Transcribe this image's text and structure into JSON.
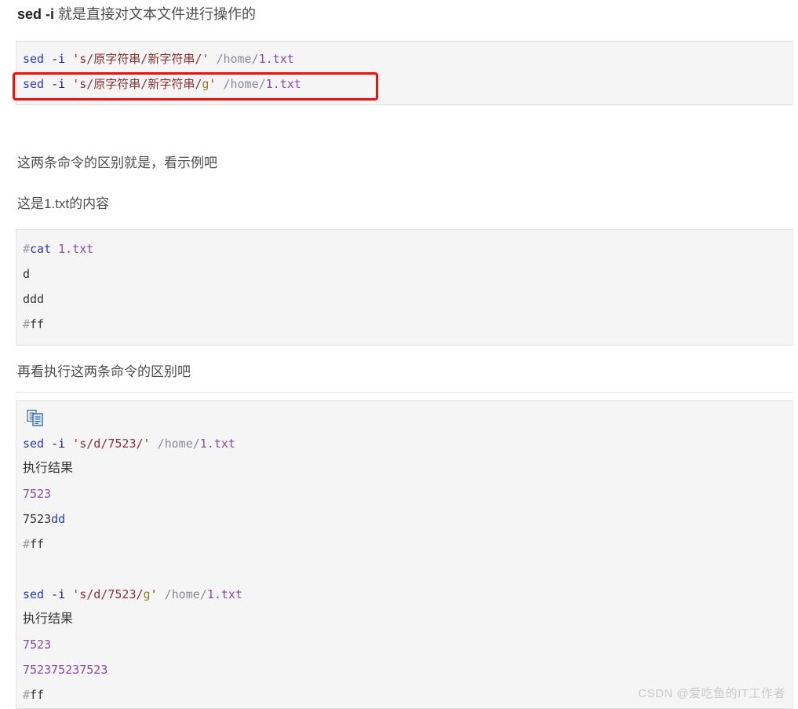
{
  "document": {
    "heading": {
      "bold_part": "sed -i",
      "rest_part": " 就是直接对文本文件进行操作的"
    },
    "paragraphs": {
      "p1": "这两条命令的区别就是，看示例吧",
      "p2": "这是1.txt的内容",
      "p3": "再看执行这两条命令的区别吧"
    },
    "watermark": "CSDN @爱吃鱼的IT工作者"
  },
  "code_block_1": {
    "name": "sed-inplace-syntax",
    "lines": [
      {
        "id": "line1",
        "tokens": [
          {
            "t": "sed",
            "c": "tk-cmd"
          },
          {
            "t": " ",
            "c": "tk-plain"
          },
          {
            "t": "-i",
            "c": "tk-opt"
          },
          {
            "t": " ",
            "c": "tk-plain"
          },
          {
            "t": "'s/原字符串/新字符串/'",
            "c": "tk-str"
          },
          {
            "t": " ",
            "c": "tk-plain"
          },
          {
            "t": "/home/",
            "c": "tk-path"
          },
          {
            "t": "1.txt",
            "c": "tk-num"
          }
        ]
      },
      {
        "id": "line2",
        "tokens": [
          {
            "t": "sed",
            "c": "tk-cmd"
          },
          {
            "t": " ",
            "c": "tk-plain"
          },
          {
            "t": "-i",
            "c": "tk-opt"
          },
          {
            "t": " ",
            "c": "tk-plain"
          },
          {
            "t": "'s/原字符串/新字符串/",
            "c": "tk-str"
          },
          {
            "t": "g",
            "c": "tk-g"
          },
          {
            "t": "'",
            "c": "tk-str"
          },
          {
            "t": " ",
            "c": "tk-plain"
          },
          {
            "t": "/home/",
            "c": "tk-path"
          },
          {
            "t": "1.txt",
            "c": "tk-num"
          }
        ]
      }
    ]
  },
  "code_block_2": {
    "name": "cat-file-contents",
    "lines": [
      {
        "id": "line1",
        "tokens": [
          {
            "t": "#",
            "c": "tk-hash"
          },
          {
            "t": "cat",
            "c": "tk-cmd"
          },
          {
            "t": " ",
            "c": "tk-plain"
          },
          {
            "t": "1.txt",
            "c": "tk-num"
          }
        ]
      },
      {
        "id": "line2",
        "tokens": [
          {
            "t": "d",
            "c": "tk-plain"
          }
        ]
      },
      {
        "id": "line3",
        "tokens": [
          {
            "t": "ddd",
            "c": "tk-plain"
          }
        ]
      },
      {
        "id": "line4",
        "tokens": [
          {
            "t": "#",
            "c": "tk-hash"
          },
          {
            "t": "ff",
            "c": "tk-plain"
          }
        ]
      }
    ]
  },
  "code_block_3": {
    "name": "sed-execution-results",
    "copy_icon_label": "copy-to-clipboard",
    "lines": [
      {
        "id": "line1",
        "cjk": false,
        "tokens": [
          {
            "t": "sed",
            "c": "tk-cmd"
          },
          {
            "t": " ",
            "c": "tk-plain"
          },
          {
            "t": "-i",
            "c": "tk-opt"
          },
          {
            "t": " ",
            "c": "tk-plain"
          },
          {
            "t": "'s/d/7523/'",
            "c": "tk-str"
          },
          {
            "t": " ",
            "c": "tk-plain"
          },
          {
            "t": "/home/",
            "c": "tk-path"
          },
          {
            "t": "1.txt",
            "c": "tk-num"
          }
        ]
      },
      {
        "id": "line2",
        "cjk": true,
        "tokens": [
          {
            "t": "执行结果",
            "c": "tk-plain"
          }
        ]
      },
      {
        "id": "line3",
        "cjk": false,
        "tokens": [
          {
            "t": "7523",
            "c": "tk-num"
          }
        ]
      },
      {
        "id": "line4",
        "cjk": false,
        "tokens": [
          {
            "t": "7523",
            "c": "tk-plain"
          },
          {
            "t": "dd",
            "c": "tk-blue"
          }
        ]
      },
      {
        "id": "line5",
        "cjk": false,
        "tokens": [
          {
            "t": "#",
            "c": "tk-hash"
          },
          {
            "t": "ff",
            "c": "tk-plain"
          }
        ]
      },
      {
        "id": "line6",
        "cjk": false,
        "tokens": []
      },
      {
        "id": "line7",
        "cjk": false,
        "tokens": [
          {
            "t": "sed",
            "c": "tk-cmd"
          },
          {
            "t": " ",
            "c": "tk-plain"
          },
          {
            "t": "-i",
            "c": "tk-opt"
          },
          {
            "t": " ",
            "c": "tk-plain"
          },
          {
            "t": "'s/d/7523/",
            "c": "tk-str"
          },
          {
            "t": "g",
            "c": "tk-g"
          },
          {
            "t": "'",
            "c": "tk-str"
          },
          {
            "t": " ",
            "c": "tk-plain"
          },
          {
            "t": "/home/",
            "c": "tk-path"
          },
          {
            "t": "1.txt",
            "c": "tk-num"
          }
        ]
      },
      {
        "id": "line8",
        "cjk": true,
        "tokens": [
          {
            "t": "执行结果",
            "c": "tk-plain"
          }
        ]
      },
      {
        "id": "line9",
        "cjk": false,
        "tokens": [
          {
            "t": "7523",
            "c": "tk-num"
          }
        ]
      },
      {
        "id": "line10",
        "cjk": false,
        "tokens": [
          {
            "t": "752375237523",
            "c": "tk-num"
          }
        ]
      },
      {
        "id": "line11",
        "cjk": false,
        "tokens": [
          {
            "t": "#",
            "c": "tk-hash"
          },
          {
            "t": "ff",
            "c": "tk-plain"
          }
        ]
      }
    ]
  },
  "annotation": {
    "redbox_label": "red-highlight-box-on-global-flag-command",
    "color": "#f50d0d"
  },
  "colors": {
    "code_background": "#f5f5f5",
    "code_border": "#dddddd",
    "text": "#4d4d4d",
    "heading": "#222222",
    "watermark": "#c9c9c9",
    "annotation_red": "#f50d0d"
  }
}
